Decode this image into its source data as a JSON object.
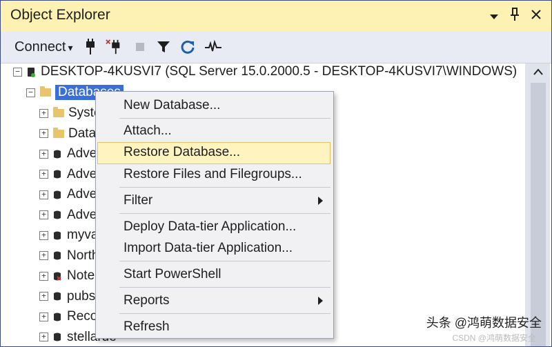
{
  "window": {
    "title": "Object Explorer"
  },
  "titlebar_icons": [
    "chevron-down-icon",
    "pin-icon",
    "close-icon"
  ],
  "toolbar": {
    "connect_label": "Connect",
    "connect_arrow": "▾"
  },
  "server": {
    "label": "DESKTOP-4KUSVI7 (SQL Server 15.0.2000.5 - DESKTOP-4KUSVI7\\WINDOWS)"
  },
  "databases_node": {
    "label": "Databases"
  },
  "tree_items": [
    {
      "label": "Syste",
      "type": "folder"
    },
    {
      "label": "Data",
      "type": "folder"
    },
    {
      "label": "Adve",
      "type": "db"
    },
    {
      "label": "Adve",
      "type": "db"
    },
    {
      "label": "Adve",
      "type": "db"
    },
    {
      "label": "Adve",
      "type": "db"
    },
    {
      "label": "myva",
      "type": "db"
    },
    {
      "label": "North",
      "type": "db"
    },
    {
      "label": "Note",
      "type": "db-error"
    },
    {
      "label": "pubs",
      "type": "db"
    },
    {
      "label": "Reco",
      "type": "db"
    },
    {
      "label": "stellarde",
      "type": "db"
    }
  ],
  "context_menu": {
    "items": [
      {
        "label": "New Database..."
      },
      {
        "label": "Attach..."
      },
      {
        "label": "Restore Database..."
      },
      {
        "label": "Restore Files and Filegroups..."
      },
      {
        "label": "Filter"
      },
      {
        "label": "Deploy Data-tier Application..."
      },
      {
        "label": "Import Data-tier Application..."
      },
      {
        "label": "Start PowerShell"
      },
      {
        "label": "Reports"
      },
      {
        "label": "Refresh"
      }
    ],
    "highlighted": "Restore Database..."
  },
  "watermark": {
    "text": "头条 @鸿萌数据安全",
    "sub": "CSDN @鸿萌数据安全"
  },
  "colors": {
    "titlebar": "#fdf2b3",
    "toolbar": "#e8ebf3",
    "selection": "#3a6fd8",
    "highlight": "#fdf4bf"
  }
}
